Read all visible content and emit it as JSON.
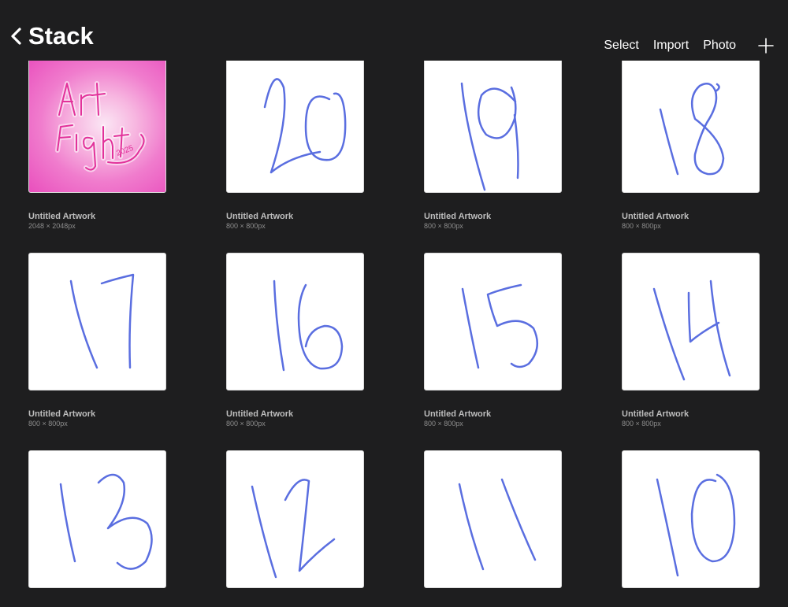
{
  "header": {
    "title": "Stack",
    "actions": {
      "select": "Select",
      "import": "Import",
      "photo": "Photo"
    }
  },
  "stroke_color": "#5a6ee0",
  "artworks": [
    {
      "title": "Untitled Artwork",
      "size": "2048 × 2048px",
      "content": "Art Fight 2025"
    },
    {
      "title": "Untitled Artwork",
      "size": "800 × 800px",
      "content": "20"
    },
    {
      "title": "Untitled Artwork",
      "size": "800 × 800px",
      "content": "19"
    },
    {
      "title": "Untitled Artwork",
      "size": "800 × 800px",
      "content": "18"
    },
    {
      "title": "Untitled Artwork",
      "size": "800 × 800px",
      "content": "17"
    },
    {
      "title": "Untitled Artwork",
      "size": "800 × 800px",
      "content": "16"
    },
    {
      "title": "Untitled Artwork",
      "size": "800 × 800px",
      "content": "15"
    },
    {
      "title": "Untitled Artwork",
      "size": "800 × 800px",
      "content": "14"
    },
    {
      "title": "",
      "size": "",
      "content": "13"
    },
    {
      "title": "",
      "size": "",
      "content": "12"
    },
    {
      "title": "",
      "size": "",
      "content": "11"
    },
    {
      "title": "",
      "size": "",
      "content": "10"
    }
  ]
}
